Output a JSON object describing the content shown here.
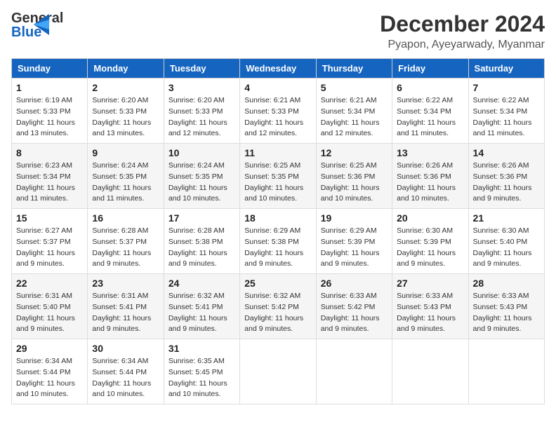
{
  "header": {
    "logo_line1": "General",
    "logo_line2": "Blue",
    "month_title": "December 2024",
    "location": "Pyapon, Ayeyarwady, Myanmar"
  },
  "days_of_week": [
    "Sunday",
    "Monday",
    "Tuesday",
    "Wednesday",
    "Thursday",
    "Friday",
    "Saturday"
  ],
  "weeks": [
    [
      {
        "day": "1",
        "sunrise": "6:19 AM",
        "sunset": "5:33 PM",
        "daylight": "11 hours and 13 minutes."
      },
      {
        "day": "2",
        "sunrise": "6:20 AM",
        "sunset": "5:33 PM",
        "daylight": "11 hours and 13 minutes."
      },
      {
        "day": "3",
        "sunrise": "6:20 AM",
        "sunset": "5:33 PM",
        "daylight": "11 hours and 12 minutes."
      },
      {
        "day": "4",
        "sunrise": "6:21 AM",
        "sunset": "5:33 PM",
        "daylight": "11 hours and 12 minutes."
      },
      {
        "day": "5",
        "sunrise": "6:21 AM",
        "sunset": "5:34 PM",
        "daylight": "11 hours and 12 minutes."
      },
      {
        "day": "6",
        "sunrise": "6:22 AM",
        "sunset": "5:34 PM",
        "daylight": "11 hours and 11 minutes."
      },
      {
        "day": "7",
        "sunrise": "6:22 AM",
        "sunset": "5:34 PM",
        "daylight": "11 hours and 11 minutes."
      }
    ],
    [
      {
        "day": "8",
        "sunrise": "6:23 AM",
        "sunset": "5:34 PM",
        "daylight": "11 hours and 11 minutes."
      },
      {
        "day": "9",
        "sunrise": "6:24 AM",
        "sunset": "5:35 PM",
        "daylight": "11 hours and 11 minutes."
      },
      {
        "day": "10",
        "sunrise": "6:24 AM",
        "sunset": "5:35 PM",
        "daylight": "11 hours and 10 minutes."
      },
      {
        "day": "11",
        "sunrise": "6:25 AM",
        "sunset": "5:35 PM",
        "daylight": "11 hours and 10 minutes."
      },
      {
        "day": "12",
        "sunrise": "6:25 AM",
        "sunset": "5:36 PM",
        "daylight": "11 hours and 10 minutes."
      },
      {
        "day": "13",
        "sunrise": "6:26 AM",
        "sunset": "5:36 PM",
        "daylight": "11 hours and 10 minutes."
      },
      {
        "day": "14",
        "sunrise": "6:26 AM",
        "sunset": "5:36 PM",
        "daylight": "11 hours and 9 minutes."
      }
    ],
    [
      {
        "day": "15",
        "sunrise": "6:27 AM",
        "sunset": "5:37 PM",
        "daylight": "11 hours and 9 minutes."
      },
      {
        "day": "16",
        "sunrise": "6:28 AM",
        "sunset": "5:37 PM",
        "daylight": "11 hours and 9 minutes."
      },
      {
        "day": "17",
        "sunrise": "6:28 AM",
        "sunset": "5:38 PM",
        "daylight": "11 hours and 9 minutes."
      },
      {
        "day": "18",
        "sunrise": "6:29 AM",
        "sunset": "5:38 PM",
        "daylight": "11 hours and 9 minutes."
      },
      {
        "day": "19",
        "sunrise": "6:29 AM",
        "sunset": "5:39 PM",
        "daylight": "11 hours and 9 minutes."
      },
      {
        "day": "20",
        "sunrise": "6:30 AM",
        "sunset": "5:39 PM",
        "daylight": "11 hours and 9 minutes."
      },
      {
        "day": "21",
        "sunrise": "6:30 AM",
        "sunset": "5:40 PM",
        "daylight": "11 hours and 9 minutes."
      }
    ],
    [
      {
        "day": "22",
        "sunrise": "6:31 AM",
        "sunset": "5:40 PM",
        "daylight": "11 hours and 9 minutes."
      },
      {
        "day": "23",
        "sunrise": "6:31 AM",
        "sunset": "5:41 PM",
        "daylight": "11 hours and 9 minutes."
      },
      {
        "day": "24",
        "sunrise": "6:32 AM",
        "sunset": "5:41 PM",
        "daylight": "11 hours and 9 minutes."
      },
      {
        "day": "25",
        "sunrise": "6:32 AM",
        "sunset": "5:42 PM",
        "daylight": "11 hours and 9 minutes."
      },
      {
        "day": "26",
        "sunrise": "6:33 AM",
        "sunset": "5:42 PM",
        "daylight": "11 hours and 9 minutes."
      },
      {
        "day": "27",
        "sunrise": "6:33 AM",
        "sunset": "5:43 PM",
        "daylight": "11 hours and 9 minutes."
      },
      {
        "day": "28",
        "sunrise": "6:33 AM",
        "sunset": "5:43 PM",
        "daylight": "11 hours and 9 minutes."
      }
    ],
    [
      {
        "day": "29",
        "sunrise": "6:34 AM",
        "sunset": "5:44 PM",
        "daylight": "11 hours and 10 minutes."
      },
      {
        "day": "30",
        "sunrise": "6:34 AM",
        "sunset": "5:44 PM",
        "daylight": "11 hours and 10 minutes."
      },
      {
        "day": "31",
        "sunrise": "6:35 AM",
        "sunset": "5:45 PM",
        "daylight": "11 hours and 10 minutes."
      },
      null,
      null,
      null,
      null
    ]
  ],
  "labels": {
    "sunrise": "Sunrise:",
    "sunset": "Sunset:",
    "daylight": "Daylight:"
  }
}
